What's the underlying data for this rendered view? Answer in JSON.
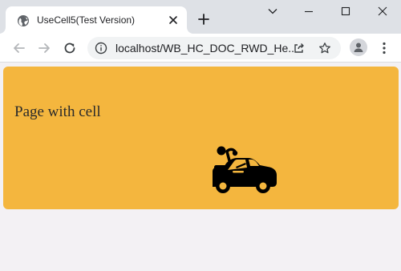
{
  "browser": {
    "tab": {
      "title": "UseCell5(Test Version)",
      "favicon": "globe-icon",
      "close_icon": "close-icon"
    },
    "new_tab_icon": "plus-icon",
    "window_controls": [
      "chevron-down-icon",
      "minimize-icon",
      "maximize-icon",
      "close-icon"
    ],
    "toolbar": {
      "back_icon": "arrow-left-icon",
      "forward_icon": "arrow-right-icon",
      "reload_icon": "reload-icon",
      "site_info_icon": "info-icon",
      "url": "localhost/WB_HC_DOC_RWD_He...",
      "share_icon": "share-icon",
      "bookmark_icon": "star-icon",
      "profile_icon": "person-icon",
      "menu_icon": "kebab-menu-icon"
    },
    "colors": {
      "tabstrip": "#dee1e6",
      "toolbar": "#ffffff",
      "omnibox": "#f1f3f4"
    }
  },
  "page": {
    "title": "Page with cell",
    "image_icon": "car-icon",
    "colors": {
      "card": "#f4b63e",
      "background": "#f3f1f4",
      "icon": "#000000"
    }
  }
}
